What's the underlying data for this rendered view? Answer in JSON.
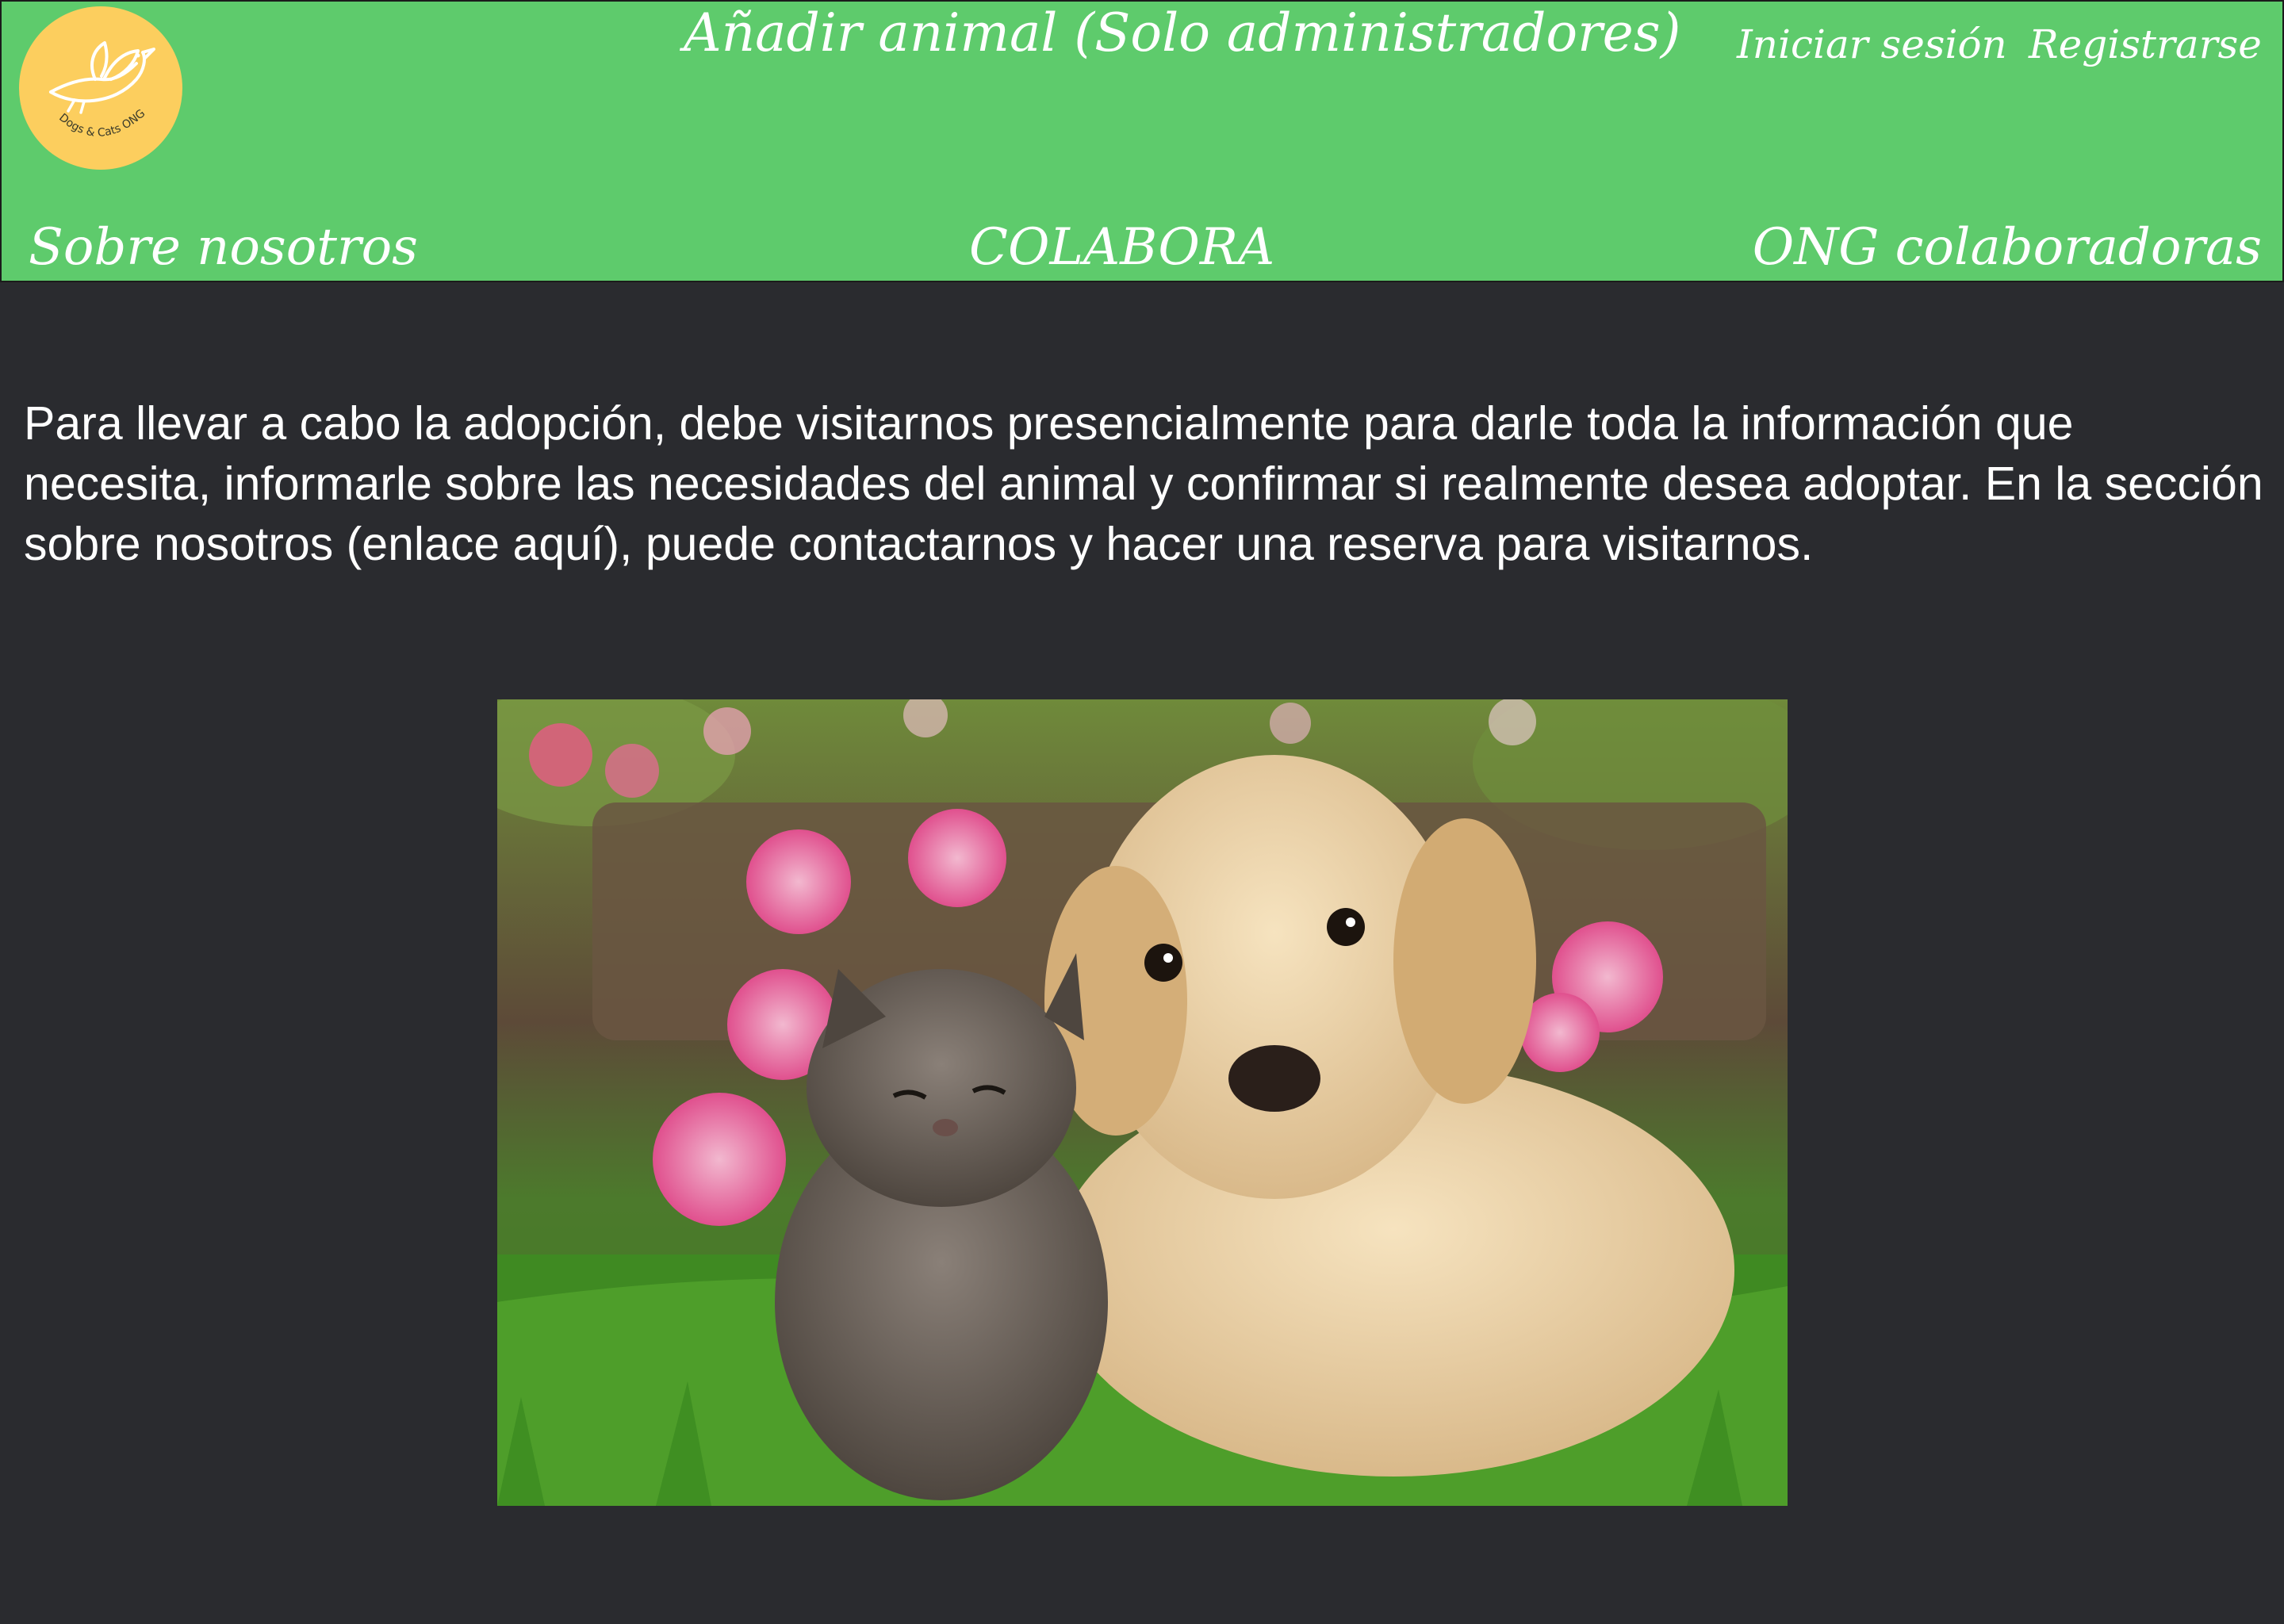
{
  "header": {
    "logo_text": "Dogs & Cats ONG",
    "admin_link": "Añadir animal (Solo administradores)",
    "login_link": "Iniciar sesión",
    "register_link": "Registrarse",
    "nav": {
      "about": "Sobre nosotros",
      "collaborate": "COLABORA",
      "partner_ngos": "ONG colaboradoras"
    }
  },
  "main": {
    "intro": "Para llevar a cabo la adopción, debe visitarnos presencialmente para darle toda la información que necesita, informarle sobre las necesidades del animal y confirmar si realmente desea adoptar. En la sección sobre nosotros (enlace aquí), puede contactarnos y hacer una reserva para visitarnos."
  },
  "colors": {
    "header_bg": "#5ecb6c",
    "page_bg": "#2a2b2f",
    "logo_bg": "#fcce5e",
    "text": "#ffffff"
  }
}
